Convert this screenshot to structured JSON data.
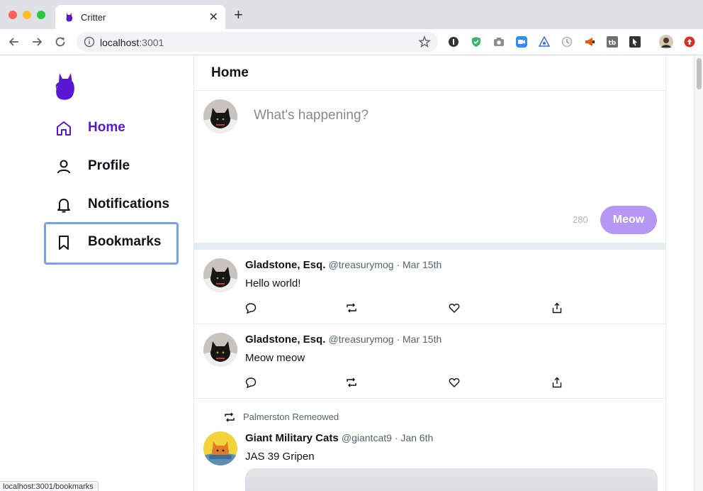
{
  "browser": {
    "tab_title": "Critter",
    "close_tab": "✕",
    "new_tab": "+",
    "url_host": "localhost",
    "url_port": ":3001",
    "status_url": "localhost:3001/bookmarks"
  },
  "colors": {
    "brand": "#5a17d3",
    "meow_button": "#b498f3",
    "focus_ring": "#7ba0f2"
  },
  "sidebar": {
    "logo_icon": "cat-icon",
    "items": [
      {
        "label": "Home",
        "icon": "home-icon",
        "active": true
      },
      {
        "label": "Profile",
        "icon": "user-icon",
        "active": false
      },
      {
        "label": "Notifications",
        "icon": "bell-icon",
        "active": false
      },
      {
        "label": "Bookmarks",
        "icon": "bookmark-icon",
        "active": false,
        "focused": true
      }
    ]
  },
  "main": {
    "title": "Home",
    "composer": {
      "placeholder": "What's happening?",
      "char_count": "280",
      "submit_label": "Meow"
    },
    "tweets": [
      {
        "author": "Gladstone, Esq.",
        "meta": "@treasurymog · Mar 15th",
        "body": "Hello world!"
      },
      {
        "author": "Gladstone, Esq.",
        "meta": "@treasurymog · Mar 15th",
        "body": "Meow meow"
      },
      {
        "remeowed_by": "Palmerston Remeowed",
        "author": "Giant Military Cats",
        "meta": "@giantcat9 · Jan 6th",
        "body": "JAS 39 Gripen"
      }
    ]
  }
}
